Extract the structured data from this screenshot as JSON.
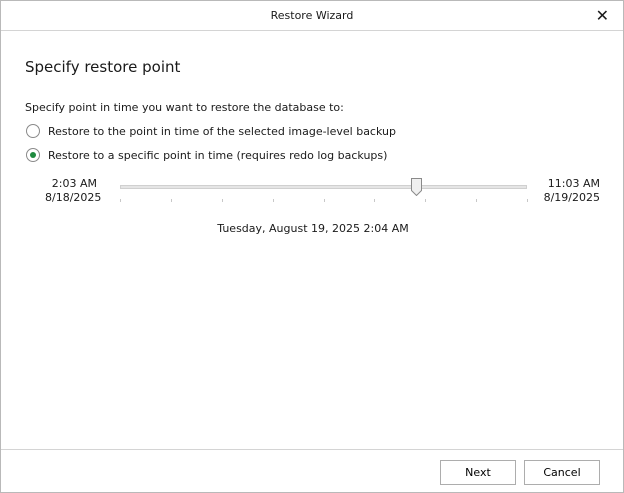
{
  "window": {
    "title": "Restore Wizard"
  },
  "page": {
    "heading": "Specify restore point",
    "prompt": "Specify point in time you want to restore the database to:"
  },
  "options": [
    {
      "label": "Restore to the point in time of the selected image-level backup",
      "selected": false
    },
    {
      "label": "Restore to a specific point in time (requires redo log backups)",
      "selected": true
    }
  ],
  "slider": {
    "start_time": "2:03 AM",
    "start_date": "8/18/2025",
    "end_time": "11:03 AM",
    "end_date": "8/19/2025",
    "position": 0.727,
    "tick_count": 9
  },
  "selected_point": "Tuesday, August 19, 2025 2:04 AM",
  "buttons": {
    "next": "Next",
    "cancel": "Cancel"
  },
  "colors": {
    "radio_selected": "#1e8a3e"
  }
}
